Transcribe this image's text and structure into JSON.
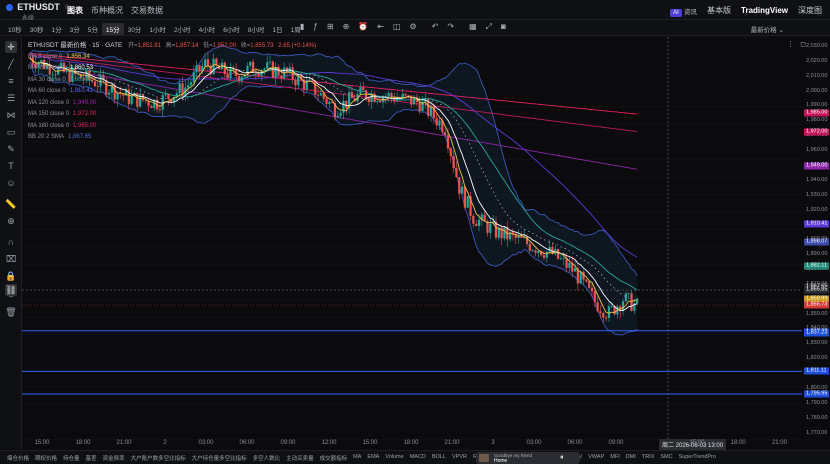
{
  "header": {
    "symbol": "ETHUSDT",
    "symbol_sub": "永续",
    "tabs": [
      {
        "label": "图表",
        "active": true
      },
      {
        "label": "币种概况",
        "active": false
      },
      {
        "label": "交易数据",
        "active": false
      }
    ],
    "ai_badge": "AI",
    "ai_label": "资讯",
    "basic_label": "基本版",
    "tradingview_label": "TradingView",
    "depth_label": "深度图"
  },
  "toolbar": {
    "intervals": [
      {
        "label": "10秒",
        "active": false
      },
      {
        "label": "30秒",
        "active": false
      },
      {
        "label": "1分",
        "active": false
      },
      {
        "label": "3分",
        "active": false
      },
      {
        "label": "5分",
        "active": false
      },
      {
        "label": "15分",
        "active": true
      },
      {
        "label": "30分",
        "active": false
      },
      {
        "label": "1小时",
        "active": false
      },
      {
        "label": "2小时",
        "active": false
      },
      {
        "label": "4小时",
        "active": false
      },
      {
        "label": "6小时",
        "active": false
      },
      {
        "label": "8小时",
        "active": false
      },
      {
        "label": "1日",
        "active": false
      },
      {
        "label": "1周",
        "active": false
      }
    ],
    "price_mode": "最新价格"
  },
  "legend": {
    "title": "ETHUSDT 最新价格 · 15 · GATE",
    "open": "1,852.81",
    "high": "1,857.14",
    "low": "1,852.00",
    "close": "1,855.73",
    "change": "2.65 (+0.14%)",
    "indicators": [
      {
        "name": "MA 5 close 0",
        "value": "1,856.34",
        "color": "#f5c044"
      },
      {
        "name": "MA 10 close 0",
        "value": "1,860.53",
        "color": "#ffffff"
      },
      {
        "name": "MA 30 close 0",
        "value": "1,882.11",
        "color": "#26a69a"
      },
      {
        "name": "MA 60 close 0",
        "value": "1,910.41",
        "color": "#5b6cff"
      },
      {
        "name": "MA 120 close 0",
        "value": "1,949.00",
        "color": "#9c27b0"
      },
      {
        "name": "MA 150 close 0",
        "value": "1,972.00",
        "color": "#e91e63"
      },
      {
        "name": "MA 180 close 0",
        "value": "1,985.00",
        "color": "#e91e63"
      },
      {
        "name": "BB 20 2 SMA",
        "value": "1,867.65",
        "color": "#4a6fd8"
      }
    ]
  },
  "time_axis": {
    "labels": [
      "15:00",
      "18:00",
      "21:00",
      "2",
      "03:00",
      "06:00",
      "09:00",
      "12:00",
      "15:00",
      "18:00",
      "21:00",
      "3",
      "03:00",
      "06:00",
      "09:00",
      "15:00",
      "18:00",
      "21:00"
    ],
    "crosshair_time": "周二 2026-06-03  13:00"
  },
  "price_axis": {
    "labels": [
      "2,030.00",
      "2,020.00",
      "2,010.00",
      "2,000.00",
      "1,990.00",
      "1,980.00",
      "1,970.00",
      "1,960.00",
      "1,950.00",
      "1,940.00",
      "1,930.00",
      "1,920.00",
      "1,910.00",
      "1,900.00",
      "1,890.00",
      "1,880.00",
      "1,870.00",
      "1,860.00",
      "1,850.00",
      "1,840.00",
      "1,830.00",
      "1,820.00",
      "1,810.00",
      "1,800.00",
      "1,790.00",
      "1,780.00",
      "1,770.00"
    ],
    "badges": [
      {
        "value": "1,985.00",
        "color": "#c2185b"
      },
      {
        "value": "1,972.00",
        "color": "#c2185b"
      },
      {
        "value": "1,949.00",
        "color": "#8e24aa"
      },
      {
        "value": "1,910.41",
        "color": "#5b3ad6"
      },
      {
        "value": "1,898.07",
        "color": "#3949ab"
      },
      {
        "value": "1,882.11",
        "color": "#1f8a7a"
      },
      {
        "value": "1,867.65",
        "color": "#2a2c31"
      },
      {
        "value": "1,865.85",
        "color": "#2a2c31"
      },
      {
        "value": "1,859.99",
        "color": "#c89a1a"
      },
      {
        "value": "1,855.73",
        "color": "#d33a3a"
      },
      {
        "value": "1,837.63",
        "color": "#1e4fd8"
      },
      {
        "value": "1,837.23",
        "color": "#1e4fd8"
      },
      {
        "value": "1,811.11",
        "color": "#1e4fd8"
      },
      {
        "value": "1,795.95",
        "color": "#1e4fd8"
      }
    ]
  },
  "horizontal_lines": [
    1838.5,
    1811.11,
    1795.95
  ],
  "bottom": {
    "indicators": [
      "爆仓价格",
      "期权价格",
      "持仓量",
      "基差",
      "资金费率",
      "大户账户数多空比指标",
      "大户持仓量多空比指标",
      "多空人数比",
      "主动买卖量",
      "成交额指标",
      "MA",
      "EMA",
      "Volume",
      "MACD",
      "BOLL",
      "VPVR",
      "RSI",
      "SAR",
      "AVL",
      "MTM",
      "WR",
      "CCI",
      "OBV",
      "VWAP",
      "MFI",
      "DMI",
      "TRIX",
      "SMC",
      "SuperTrendPro"
    ],
    "popup_line1": "Goodbye my friend",
    "popup_line2": "Home"
  },
  "colors": {
    "up": "#26a69a",
    "down": "#ef5350",
    "background": "#0b0b0d",
    "bb": "#3f5fd1"
  },
  "chart_data": {
    "type": "candlestick",
    "y_range": [
      1765,
      2036
    ],
    "candle_count": 170,
    "candles": []
  }
}
